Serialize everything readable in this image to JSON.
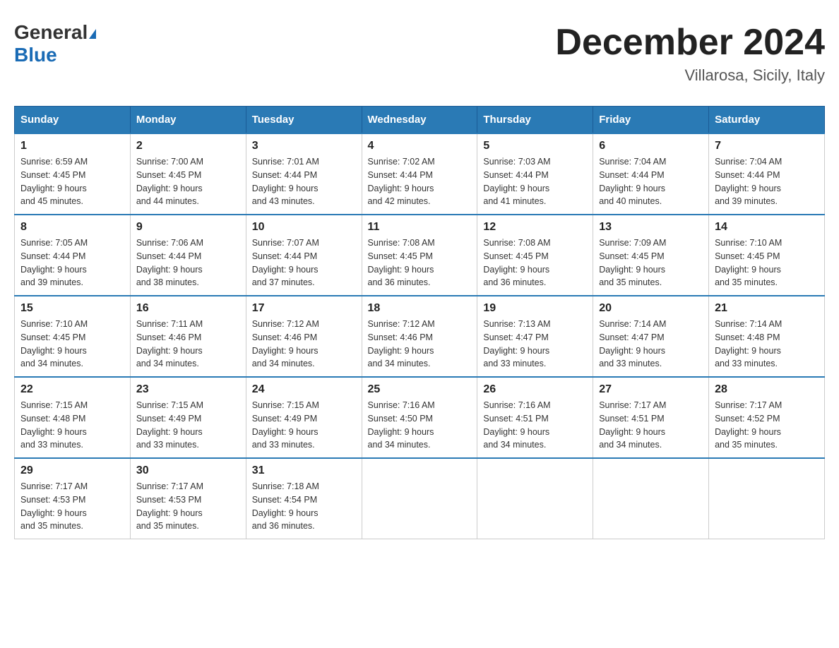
{
  "header": {
    "logo_general": "General",
    "logo_blue": "Blue",
    "month_title": "December 2024",
    "location": "Villarosa, Sicily, Italy"
  },
  "days_of_week": [
    "Sunday",
    "Monday",
    "Tuesday",
    "Wednesday",
    "Thursday",
    "Friday",
    "Saturday"
  ],
  "weeks": [
    [
      {
        "day": "1",
        "sunrise": "6:59 AM",
        "sunset": "4:45 PM",
        "daylight": "9 hours and 45 minutes."
      },
      {
        "day": "2",
        "sunrise": "7:00 AM",
        "sunset": "4:45 PM",
        "daylight": "9 hours and 44 minutes."
      },
      {
        "day": "3",
        "sunrise": "7:01 AM",
        "sunset": "4:44 PM",
        "daylight": "9 hours and 43 minutes."
      },
      {
        "day": "4",
        "sunrise": "7:02 AM",
        "sunset": "4:44 PM",
        "daylight": "9 hours and 42 minutes."
      },
      {
        "day": "5",
        "sunrise": "7:03 AM",
        "sunset": "4:44 PM",
        "daylight": "9 hours and 41 minutes."
      },
      {
        "day": "6",
        "sunrise": "7:04 AM",
        "sunset": "4:44 PM",
        "daylight": "9 hours and 40 minutes."
      },
      {
        "day": "7",
        "sunrise": "7:04 AM",
        "sunset": "4:44 PM",
        "daylight": "9 hours and 39 minutes."
      }
    ],
    [
      {
        "day": "8",
        "sunrise": "7:05 AM",
        "sunset": "4:44 PM",
        "daylight": "9 hours and 39 minutes."
      },
      {
        "day": "9",
        "sunrise": "7:06 AM",
        "sunset": "4:44 PM",
        "daylight": "9 hours and 38 minutes."
      },
      {
        "day": "10",
        "sunrise": "7:07 AM",
        "sunset": "4:44 PM",
        "daylight": "9 hours and 37 minutes."
      },
      {
        "day": "11",
        "sunrise": "7:08 AM",
        "sunset": "4:45 PM",
        "daylight": "9 hours and 36 minutes."
      },
      {
        "day": "12",
        "sunrise": "7:08 AM",
        "sunset": "4:45 PM",
        "daylight": "9 hours and 36 minutes."
      },
      {
        "day": "13",
        "sunrise": "7:09 AM",
        "sunset": "4:45 PM",
        "daylight": "9 hours and 35 minutes."
      },
      {
        "day": "14",
        "sunrise": "7:10 AM",
        "sunset": "4:45 PM",
        "daylight": "9 hours and 35 minutes."
      }
    ],
    [
      {
        "day": "15",
        "sunrise": "7:10 AM",
        "sunset": "4:45 PM",
        "daylight": "9 hours and 34 minutes."
      },
      {
        "day": "16",
        "sunrise": "7:11 AM",
        "sunset": "4:46 PM",
        "daylight": "9 hours and 34 minutes."
      },
      {
        "day": "17",
        "sunrise": "7:12 AM",
        "sunset": "4:46 PM",
        "daylight": "9 hours and 34 minutes."
      },
      {
        "day": "18",
        "sunrise": "7:12 AM",
        "sunset": "4:46 PM",
        "daylight": "9 hours and 34 minutes."
      },
      {
        "day": "19",
        "sunrise": "7:13 AM",
        "sunset": "4:47 PM",
        "daylight": "9 hours and 33 minutes."
      },
      {
        "day": "20",
        "sunrise": "7:14 AM",
        "sunset": "4:47 PM",
        "daylight": "9 hours and 33 minutes."
      },
      {
        "day": "21",
        "sunrise": "7:14 AM",
        "sunset": "4:48 PM",
        "daylight": "9 hours and 33 minutes."
      }
    ],
    [
      {
        "day": "22",
        "sunrise": "7:15 AM",
        "sunset": "4:48 PM",
        "daylight": "9 hours and 33 minutes."
      },
      {
        "day": "23",
        "sunrise": "7:15 AM",
        "sunset": "4:49 PM",
        "daylight": "9 hours and 33 minutes."
      },
      {
        "day": "24",
        "sunrise": "7:15 AM",
        "sunset": "4:49 PM",
        "daylight": "9 hours and 33 minutes."
      },
      {
        "day": "25",
        "sunrise": "7:16 AM",
        "sunset": "4:50 PM",
        "daylight": "9 hours and 34 minutes."
      },
      {
        "day": "26",
        "sunrise": "7:16 AM",
        "sunset": "4:51 PM",
        "daylight": "9 hours and 34 minutes."
      },
      {
        "day": "27",
        "sunrise": "7:17 AM",
        "sunset": "4:51 PM",
        "daylight": "9 hours and 34 minutes."
      },
      {
        "day": "28",
        "sunrise": "7:17 AM",
        "sunset": "4:52 PM",
        "daylight": "9 hours and 35 minutes."
      }
    ],
    [
      {
        "day": "29",
        "sunrise": "7:17 AM",
        "sunset": "4:53 PM",
        "daylight": "9 hours and 35 minutes."
      },
      {
        "day": "30",
        "sunrise": "7:17 AM",
        "sunset": "4:53 PM",
        "daylight": "9 hours and 35 minutes."
      },
      {
        "day": "31",
        "sunrise": "7:18 AM",
        "sunset": "4:54 PM",
        "daylight": "9 hours and 36 minutes."
      },
      null,
      null,
      null,
      null
    ]
  ],
  "labels": {
    "sunrise": "Sunrise:",
    "sunset": "Sunset:",
    "daylight": "Daylight:"
  }
}
